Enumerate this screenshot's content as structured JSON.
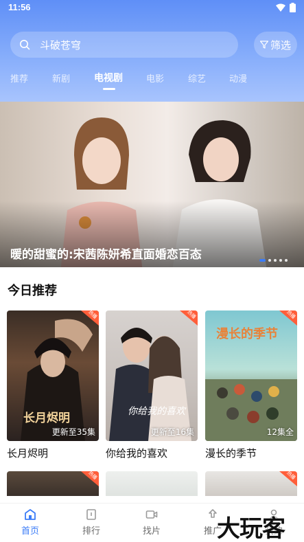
{
  "status_bar": {
    "time": "11:56"
  },
  "search": {
    "query": "斗破苍穹"
  },
  "filter": {
    "label": "筛选"
  },
  "tabs": [
    {
      "label": "推荐",
      "active": false
    },
    {
      "label": "新剧",
      "active": false
    },
    {
      "label": "电视剧",
      "active": true
    },
    {
      "label": "电影",
      "active": false
    },
    {
      "label": "综艺",
      "active": false
    },
    {
      "label": "动漫",
      "active": false
    }
  ],
  "banner": {
    "caption": "暖的甜蜜的:宋茜陈妍希直面婚恋百态",
    "slide_count": 5,
    "current_slide": 1
  },
  "section": {
    "title": "今日推荐"
  },
  "cards": [
    {
      "title": "长月烬明",
      "episode": "更新至35集",
      "badge": "热播",
      "poster_text": "长月烬明"
    },
    {
      "title": "你给我的喜欢",
      "episode": "更新至16集",
      "badge": "热播",
      "poster_text": "你给我的喜欢"
    },
    {
      "title": "漫长的季节",
      "episode": "12集全",
      "badge": "热播",
      "poster_text": "漫长的季节"
    }
  ],
  "second_row_badges": [
    "热播",
    "",
    "热播",
    ""
  ],
  "bottom_nav": [
    {
      "label": "首页",
      "icon": "home-icon",
      "active": true
    },
    {
      "label": "排行",
      "icon": "ranking-icon",
      "active": false
    },
    {
      "label": "找片",
      "icon": "video-icon",
      "active": false
    },
    {
      "label": "推广",
      "icon": "share-icon",
      "active": false
    },
    {
      "label": "我的",
      "icon": "user-icon",
      "active": false
    }
  ],
  "watermark": "大玩客",
  "colors": {
    "accent": "#3b7cf7",
    "header_top": "#5f8ff7",
    "hot_badge": "#ff5e3a"
  }
}
